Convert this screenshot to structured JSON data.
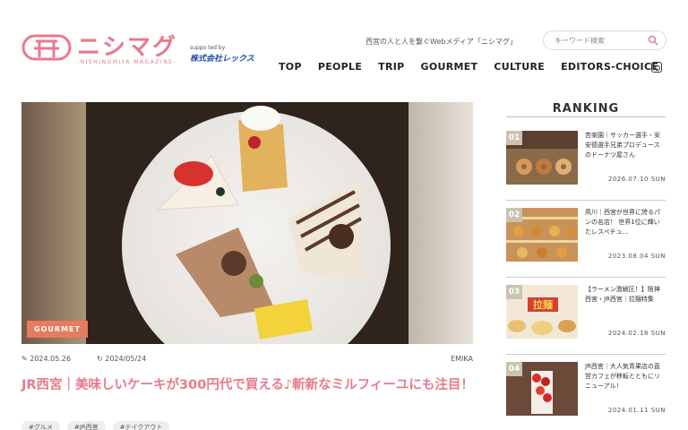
{
  "brand": {
    "logo_text": "ニシマグ",
    "logo_sub": "-NISHINOMIYA MAGAZINE-",
    "supported_by": "suppo ted by",
    "company": "株式会社レックス",
    "accent": "#e87a8b"
  },
  "header": {
    "tagline": "西宮の人と人を繋ぐWebメディア「ニシマグ」",
    "search_placeholder": "キーワード検索"
  },
  "nav": {
    "items": [
      "TOP",
      "PEOPLE",
      "TRIP",
      "GOURMET",
      "CULTURE",
      "EDITORS-CHOICE"
    ]
  },
  "article": {
    "category": "GOURMET",
    "published": "2024.05.26",
    "updated": "2024/05/24",
    "author": "EMIKA",
    "title": "JR西宮｜美味しいケーキが300円代で買える♪斬新なミルフィーユにも注目！",
    "tags": [
      "#グルメ",
      "#JR西宮",
      "#テイクアウト"
    ]
  },
  "ranking": {
    "heading": "RANKING",
    "items": [
      {
        "rank": "01",
        "text": "苦楽園｜サッカー選手・安安德選手兄弟プロデュースのドーナツ屋さん",
        "date": "2026.07.10 SUN"
      },
      {
        "rank": "02",
        "text": "夙川｜西宮が世界に誇るパンの名店！ 世界1位に輝いたレスペチュ…",
        "date": "2023.08.04 SUN"
      },
      {
        "rank": "03",
        "text": "【ラーメン激戦区！】阪神西宮・JR西宮｜拉麺特集",
        "date": "2024.02.18 SUN"
      },
      {
        "rank": "04",
        "text": "JR西宮｜大人気青果店の直営カフェが移転とともにリニューアル！",
        "date": "2024.01.11 SUN"
      }
    ]
  }
}
